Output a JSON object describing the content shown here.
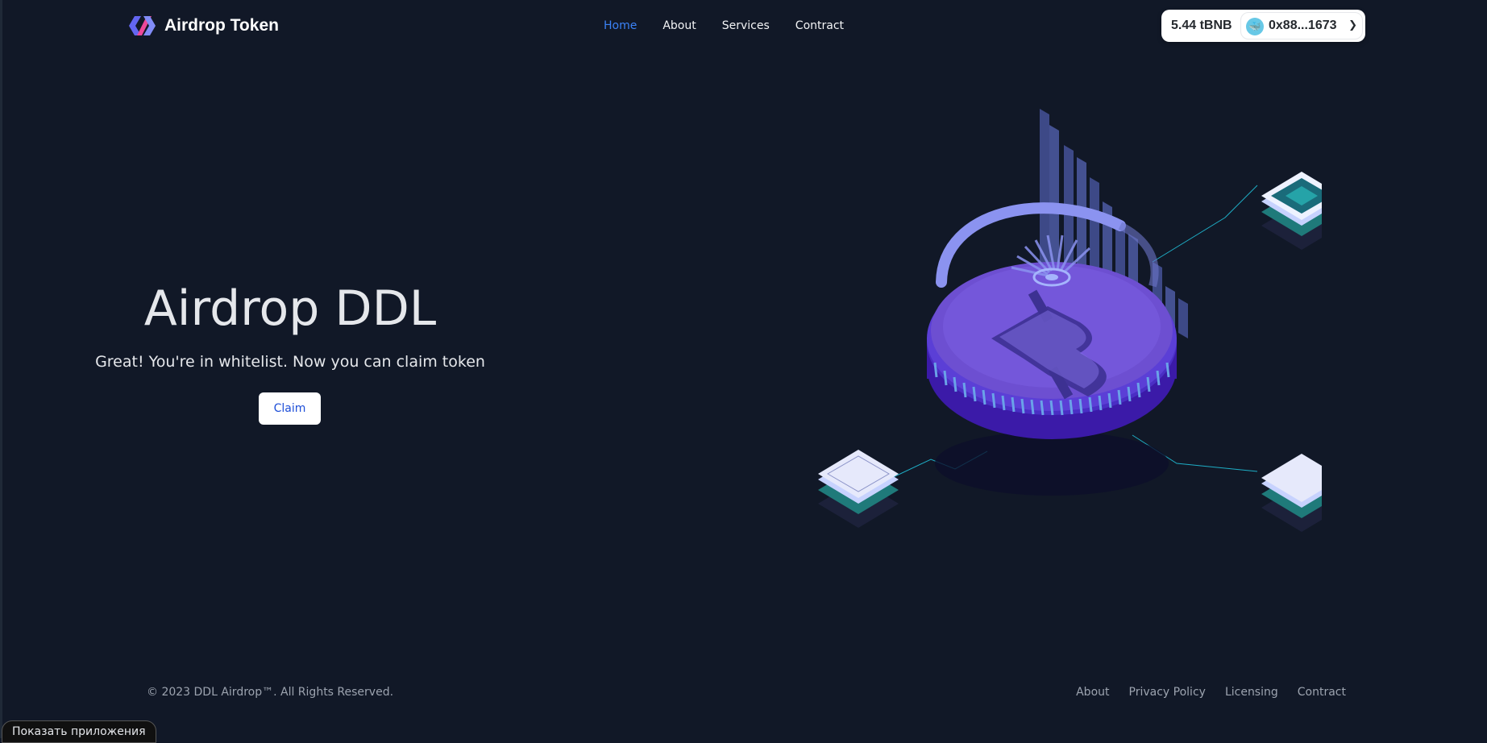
{
  "header": {
    "brand_name": "Airdrop Token",
    "nav": [
      "Home",
      "About",
      "Services",
      "Contract"
    ],
    "active_nav": "Home"
  },
  "wallet": {
    "balance": "5.44 tBNB",
    "address": "0x88...1673",
    "chevron_icon": "chevron-down-icon"
  },
  "hero": {
    "title": "Airdrop DDL",
    "subtitle": "Great! You're in whitelist. Now you can claim token",
    "claim_label": "Claim"
  },
  "footer": {
    "copyright": "© 2023 DDL Airdrop™. All Rights Reserved.",
    "links": [
      "About",
      "Privacy Policy",
      "Licensing",
      "Contract"
    ]
  },
  "system": {
    "show_apps_label": "Показать приложения"
  },
  "colors": {
    "background": "#111827",
    "accent": "#3b82f6",
    "coin": "#6d4fd1",
    "link_line": "#22d3ee"
  }
}
